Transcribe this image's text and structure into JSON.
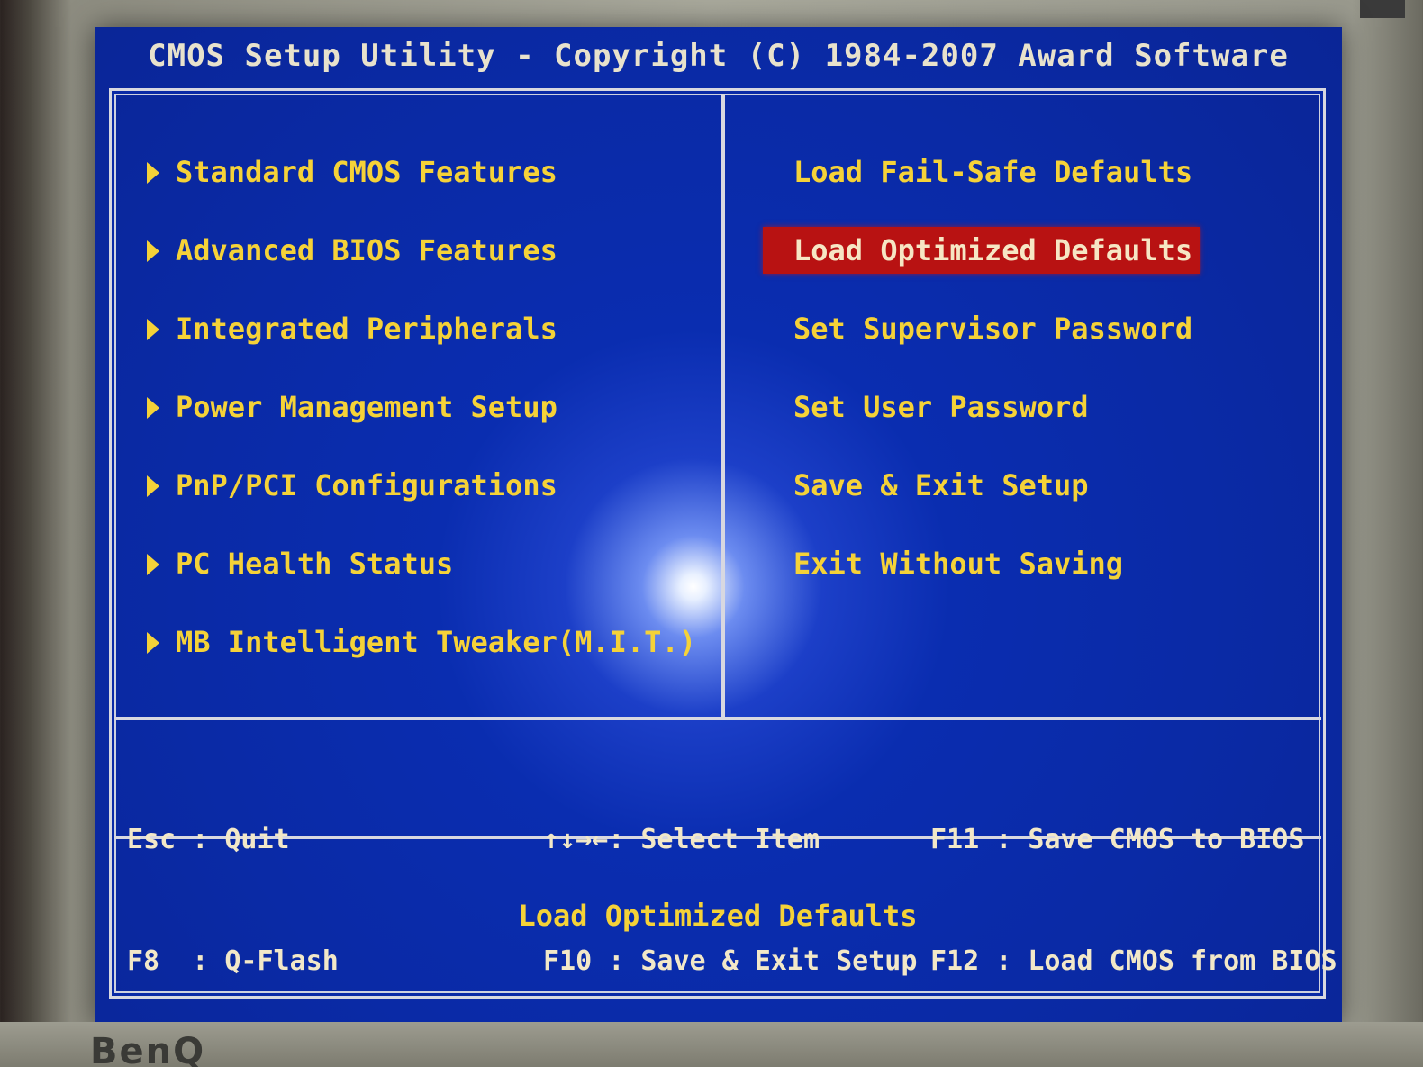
{
  "header": {
    "title": "CMOS Setup Utility - Copyright (C) 1984-2007 Award Software"
  },
  "menu_left": [
    {
      "label": "Standard CMOS Features"
    },
    {
      "label": "Advanced BIOS Features"
    },
    {
      "label": "Integrated Peripherals"
    },
    {
      "label": "Power Management Setup"
    },
    {
      "label": "PnP/PCI Configurations"
    },
    {
      "label": "PC Health Status"
    },
    {
      "label": "MB Intelligent Tweaker(M.I.T.)"
    }
  ],
  "menu_right": [
    {
      "label": "Load Fail-Safe Defaults",
      "selected": false
    },
    {
      "label": "Load Optimized Defaults",
      "selected": true
    },
    {
      "label": "Set Supervisor Password",
      "selected": false
    },
    {
      "label": "Set User Password",
      "selected": false
    },
    {
      "label": "Save & Exit Setup",
      "selected": false
    },
    {
      "label": "Exit Without Saving",
      "selected": false
    }
  ],
  "help_keys": {
    "col1": [
      "Esc : Quit",
      "F8  : Q-Flash"
    ],
    "col2": [
      "↑↓→←: Select Item",
      "F10 : Save & Exit Setup"
    ],
    "col3": [
      "F11 : Save CMOS to BIOS",
      "F12 : Load CMOS from BIOS"
    ]
  },
  "status": {
    "text": "Load Optimized Defaults"
  },
  "monitor": {
    "brand": "BenQ"
  },
  "colors": {
    "background": "#0a2aa6",
    "item_text": "#f5d238",
    "highlight": "#b81212",
    "border": "#d8d8e0"
  }
}
